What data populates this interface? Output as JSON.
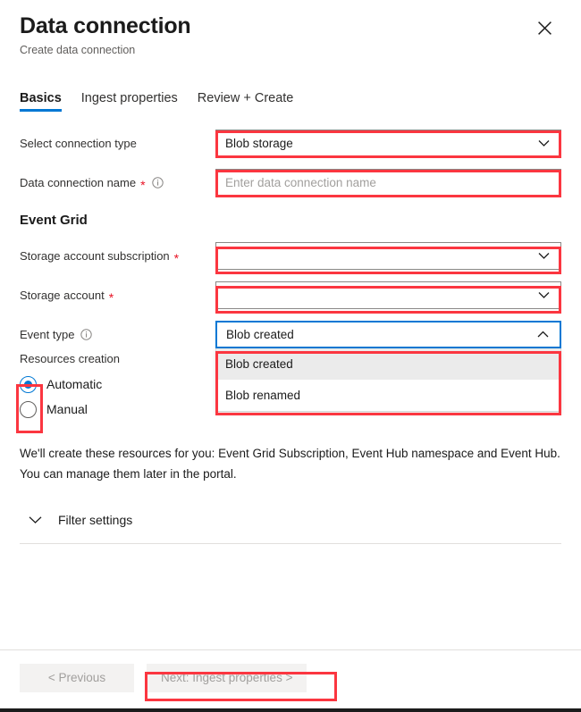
{
  "header": {
    "title": "Data connection",
    "subtitle": "Create data connection",
    "close_label": "Close"
  },
  "tabs": [
    {
      "label": "Basics",
      "active": true
    },
    {
      "label": "Ingest properties",
      "active": false
    },
    {
      "label": "Review + Create",
      "active": false
    }
  ],
  "form": {
    "connection_type": {
      "label": "Select connection type",
      "value": "Blob storage"
    },
    "data_connection_name": {
      "label": "Data connection name",
      "required": "*",
      "placeholder": "Enter data connection name",
      "value": ""
    },
    "section_event_grid": "Event Grid",
    "storage_account_subscription": {
      "label": "Storage account subscription",
      "required": "*",
      "value": ""
    },
    "storage_account": {
      "label": "Storage account",
      "required": "*",
      "value": ""
    },
    "event_type": {
      "label": "Event type",
      "value": "Blob created",
      "expanded": true,
      "options": [
        {
          "label": "Blob created",
          "selected": true
        },
        {
          "label": "Blob renamed",
          "selected": false
        }
      ]
    },
    "resources_creation": {
      "label": "Resources creation",
      "options": [
        {
          "label": "Automatic",
          "checked": true
        },
        {
          "label": "Manual",
          "checked": false
        }
      ]
    },
    "note": "We'll create these resources for you: Event Grid Subscription, Event Hub namespace and Event Hub. You can manage them later in the portal.",
    "filter_settings": {
      "label": "Filter settings",
      "expanded": false
    }
  },
  "footer": {
    "previous_label": "< Previous",
    "next_label": "Next: Ingest properties >"
  },
  "colors": {
    "accent": "#0078d4",
    "highlight": "#fb3640",
    "required": "#e81123",
    "disabled_button_bg": "#f3f2f1",
    "disabled_button_text": "#a19f9d"
  }
}
